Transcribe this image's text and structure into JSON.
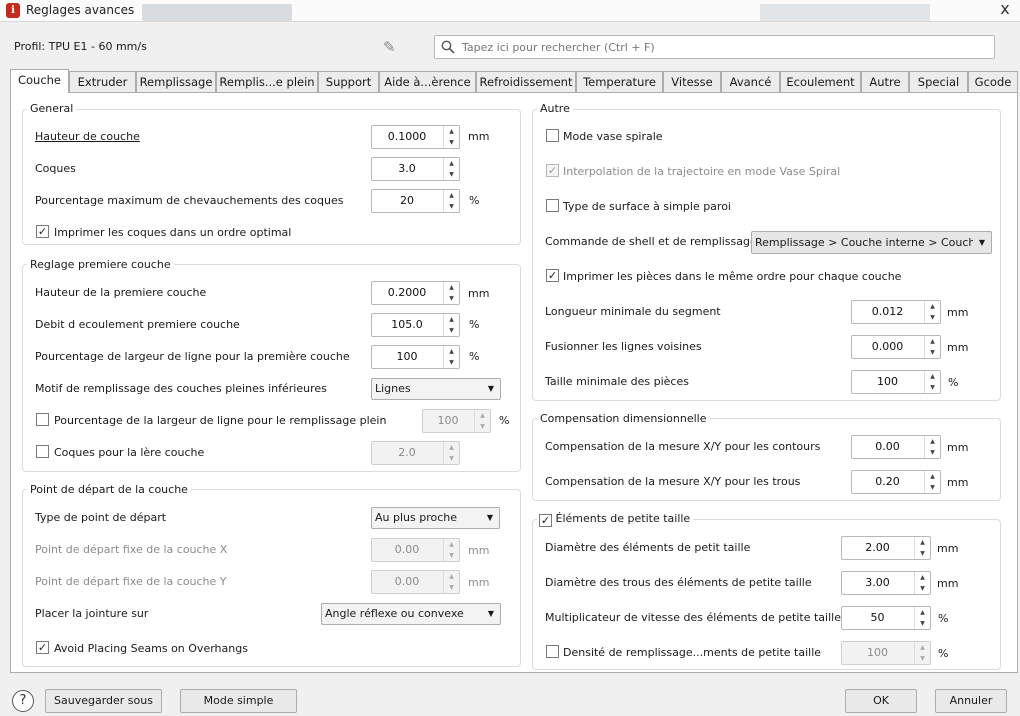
{
  "window": {
    "title": "Reglages avances",
    "close": "x"
  },
  "header": {
    "profile": "Profil: TPU E1 - 60 mm/s",
    "search_placeholder": "Tapez ici pour rechercher (Ctrl + F)"
  },
  "tabs": [
    "Couche",
    "Extruder",
    "Remplissage",
    "Remplis...e plein",
    "Support",
    "Aide à...èrence",
    "Refroidissement",
    "Temperature",
    "Vitesse",
    "Avancé",
    "Ecoulement",
    "Autre",
    "Special",
    "Gcode"
  ],
  "general": {
    "title": "General",
    "layer_height": {
      "label": "Hauteur de couche",
      "value": "0.1000",
      "unit": "mm"
    },
    "shells": {
      "label": "Coques",
      "value": "3.0"
    },
    "overlap": {
      "label": "Pourcentage maximum de chevauchements des coques",
      "value": "20",
      "unit": "%"
    },
    "optimal_order": {
      "label": "Imprimer les coques dans un ordre optimal",
      "checked": true
    }
  },
  "first_layer": {
    "title": "Reglage premiere couche",
    "height": {
      "label": "Hauteur de la premiere couche",
      "value": "0.2000",
      "unit": "mm"
    },
    "flow": {
      "label": "Debit d ecoulement premiere couche",
      "value": "105.0",
      "unit": "%"
    },
    "line_width": {
      "label": "Pourcentage de largeur de ligne pour la première couche",
      "value": "100",
      "unit": "%"
    },
    "fill_pattern": {
      "label": "Motif de remplissage des couches pleines inférieures",
      "value": "Lignes"
    },
    "solid_width": {
      "label": "Pourcentage de la largeur de ligne pour le remplissage plein",
      "value": "100",
      "unit": "%",
      "checked": false
    },
    "first_shells": {
      "label": "Coques pour la lère couche",
      "value": "2.0",
      "checked": false
    }
  },
  "start_point": {
    "title": "Point de départ de la couche",
    "type": {
      "label": "Type de point de départ",
      "value": "Au plus proche"
    },
    "fixed_x": {
      "label": "Point de départ fixe de la couche X",
      "value": "0.00",
      "unit": "mm"
    },
    "fixed_y": {
      "label": "Point de départ fixe de la couche Y",
      "value": "0.00",
      "unit": "mm"
    },
    "seam": {
      "label": "Placer la jointure sur",
      "value": "Angle réflexe ou convexe"
    },
    "avoid_overhangs": {
      "label": "Avoid Placing Seams on Overhangs",
      "checked": true
    }
  },
  "other": {
    "title": "Autre",
    "spiral_vase": {
      "label": "Mode vase spirale",
      "checked": false
    },
    "spiral_interp": {
      "label": "Interpolation de la trajectoire en mode Vase Spiral",
      "checked": true
    },
    "single_wall": {
      "label": "Type de surface à simple paroi",
      "checked": false
    },
    "shell_order": {
      "label": "Commande de shell et de remplissage",
      "value": "Remplissage > Couche interne > Couche externe"
    },
    "same_order": {
      "label": "Imprimer les pièces dans le même ordre pour chaque couche",
      "checked": true
    },
    "min_segment": {
      "label": "Longueur minimale du segment",
      "value": "0.012",
      "unit": "mm"
    },
    "merge_lines": {
      "label": "Fusionner les lignes voisines",
      "value": "0.000",
      "unit": "mm"
    },
    "min_part": {
      "label": "Taille minimale des pièces",
      "value": "100",
      "unit": "%"
    }
  },
  "compensation": {
    "title": "Compensation dimensionnelle",
    "xy_contours": {
      "label": "Compensation de la mesure X/Y pour les contours",
      "value": "0.00",
      "unit": "mm"
    },
    "xy_holes": {
      "label": "Compensation de la mesure X/Y pour les trous",
      "value": "0.20",
      "unit": "mm"
    }
  },
  "small": {
    "title": "Éléments de petite taille",
    "checked": true,
    "diameter": {
      "label": "Diamètre des éléments de petit taille",
      "value": "2.00",
      "unit": "mm"
    },
    "hole_diameter": {
      "label": "Diamètre des trous des éléments de petite taille",
      "value": "3.00",
      "unit": "mm"
    },
    "speed": {
      "label": "Multiplicateur de vitesse des éléments de petite taille",
      "value": "50",
      "unit": "%"
    },
    "density": {
      "label": "Densité de remplissage...ments de petite taille",
      "value": "100",
      "unit": "%",
      "checked": false
    }
  },
  "footer": {
    "help": "?",
    "save_as": "Sauvegarder sous",
    "simple_mode": "Mode simple",
    "ok": "OK",
    "cancel": "Annuler"
  }
}
